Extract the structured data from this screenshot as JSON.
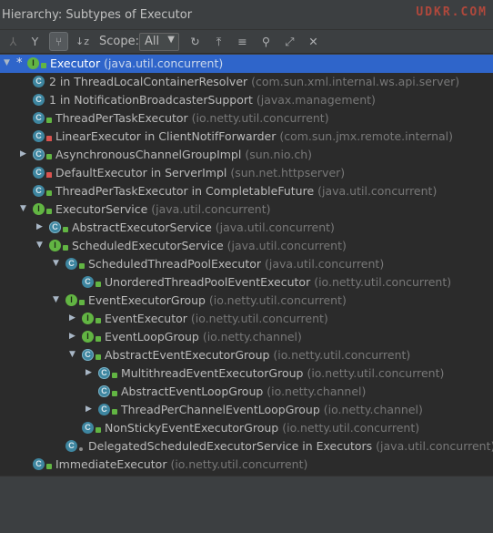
{
  "window": {
    "title": "Hierarchy:  Subtypes of Executor",
    "watermark": "UDKR.COM"
  },
  "toolbar": {
    "scope_label": "Scope:",
    "scope_value": "All",
    "buttons": [
      {
        "name": "supertypes-hierarchy-icon",
        "glyph": "⅄"
      },
      {
        "name": "subtypes-hierarchy-icon",
        "glyph": "Y"
      },
      {
        "name": "type-hierarchy-icon",
        "glyph": "⑂"
      },
      {
        "name": "sort-alphabetically-icon",
        "glyph": "↓z"
      },
      {
        "name": "refresh-icon",
        "glyph": "↻"
      },
      {
        "name": "export-icon",
        "glyph": "⤒"
      },
      {
        "name": "expand-all-icon",
        "glyph": "≡"
      },
      {
        "name": "pin-icon",
        "glyph": "⚲"
      },
      {
        "name": "open-in-new-icon",
        "glyph": "⤢"
      },
      {
        "name": "close-icon",
        "glyph": "✕"
      }
    ]
  },
  "tree": [
    {
      "depth": 0,
      "toggle": "▼",
      "star": "*",
      "icon": "i",
      "badge": "green",
      "name": "Executor",
      "pkg": "(java.util.concurrent)",
      "selected": true
    },
    {
      "depth": 1,
      "toggle": "",
      "icon": "c",
      "badge": "",
      "name": "2 in ThreadLocalContainerResolver",
      "pkg": "(com.sun.xml.internal.ws.api.server)"
    },
    {
      "depth": 1,
      "toggle": "",
      "icon": "c",
      "badge": "",
      "name": "1 in NotificationBroadcasterSupport",
      "pkg": "(javax.management)"
    },
    {
      "depth": 1,
      "toggle": "",
      "icon": "c",
      "badge": "green",
      "name": "ThreadPerTaskExecutor",
      "pkg": "(io.netty.util.concurrent)"
    },
    {
      "depth": 1,
      "toggle": "",
      "icon": "c",
      "badge": "lock",
      "name": "LinearExecutor in ClientNotifForwarder",
      "pkg": "(com.sun.jmx.remote.internal)"
    },
    {
      "depth": 1,
      "toggle": "▶",
      "icon": "a",
      "badge": "green",
      "name": "AsynchronousChannelGroupImpl",
      "pkg": "(sun.nio.ch)"
    },
    {
      "depth": 1,
      "toggle": "",
      "icon": "c",
      "badge": "lock",
      "name": "DefaultExecutor in ServerImpl",
      "pkg": "(sun.net.httpserver)"
    },
    {
      "depth": 1,
      "toggle": "",
      "icon": "c",
      "badge": "green",
      "name": "ThreadPerTaskExecutor in CompletableFuture",
      "pkg": "(java.util.concurrent)"
    },
    {
      "depth": 1,
      "toggle": "▼",
      "icon": "i",
      "badge": "green",
      "name": "ExecutorService",
      "pkg": "(java.util.concurrent)"
    },
    {
      "depth": 2,
      "toggle": "▶",
      "icon": "a",
      "badge": "green",
      "name": "AbstractExecutorService",
      "pkg": "(java.util.concurrent)"
    },
    {
      "depth": 2,
      "toggle": "▼",
      "icon": "i",
      "badge": "green",
      "name": "ScheduledExecutorService",
      "pkg": "(java.util.concurrent)"
    },
    {
      "depth": 3,
      "toggle": "▼",
      "icon": "c",
      "badge": "green",
      "name": "ScheduledThreadPoolExecutor",
      "pkg": "(java.util.concurrent)"
    },
    {
      "depth": 4,
      "toggle": "",
      "icon": "c",
      "badge": "green",
      "name": "UnorderedThreadPoolEventExecutor",
      "pkg": "(io.netty.util.concurrent)"
    },
    {
      "depth": 3,
      "toggle": "▼",
      "icon": "i",
      "badge": "green",
      "name": "EventExecutorGroup",
      "pkg": "(io.netty.util.concurrent)"
    },
    {
      "depth": 4,
      "toggle": "▶",
      "icon": "i",
      "badge": "green",
      "name": "EventExecutor",
      "pkg": "(io.netty.util.concurrent)"
    },
    {
      "depth": 4,
      "toggle": "▶",
      "icon": "i",
      "badge": "green",
      "name": "EventLoopGroup",
      "pkg": "(io.netty.channel)"
    },
    {
      "depth": 4,
      "toggle": "▼",
      "icon": "a",
      "badge": "green",
      "name": "AbstractEventExecutorGroup",
      "pkg": "(io.netty.util.concurrent)"
    },
    {
      "depth": 5,
      "toggle": "▶",
      "icon": "a",
      "badge": "green",
      "name": "MultithreadEventExecutorGroup",
      "pkg": "(io.netty.util.concurrent)"
    },
    {
      "depth": 5,
      "toggle": "",
      "icon": "a",
      "badge": "green",
      "name": "AbstractEventLoopGroup",
      "pkg": "(io.netty.channel)"
    },
    {
      "depth": 5,
      "toggle": "▶",
      "icon": "c",
      "badge": "green",
      "name": "ThreadPerChannelEventLoopGroup",
      "pkg": "(io.netty.channel)"
    },
    {
      "depth": 4,
      "toggle": "",
      "icon": "c",
      "badge": "green",
      "name": "NonStickyEventExecutorGroup",
      "pkg": "(io.netty.util.concurrent)"
    },
    {
      "depth": 3,
      "toggle": "",
      "icon": "c",
      "badge": "dot",
      "name": "DelegatedScheduledExecutorService in Executors",
      "pkg": "(java.util.concurrent)"
    },
    {
      "depth": 1,
      "toggle": "",
      "icon": "c",
      "badge": "green",
      "name": "ImmediateExecutor",
      "pkg": "(io.netty.util.concurrent)"
    }
  ],
  "colors": {
    "selection": "#2f65ca",
    "class_icon": "#3e86a0",
    "interface_icon": "#62b543",
    "lock_badge": "#d9534f"
  }
}
